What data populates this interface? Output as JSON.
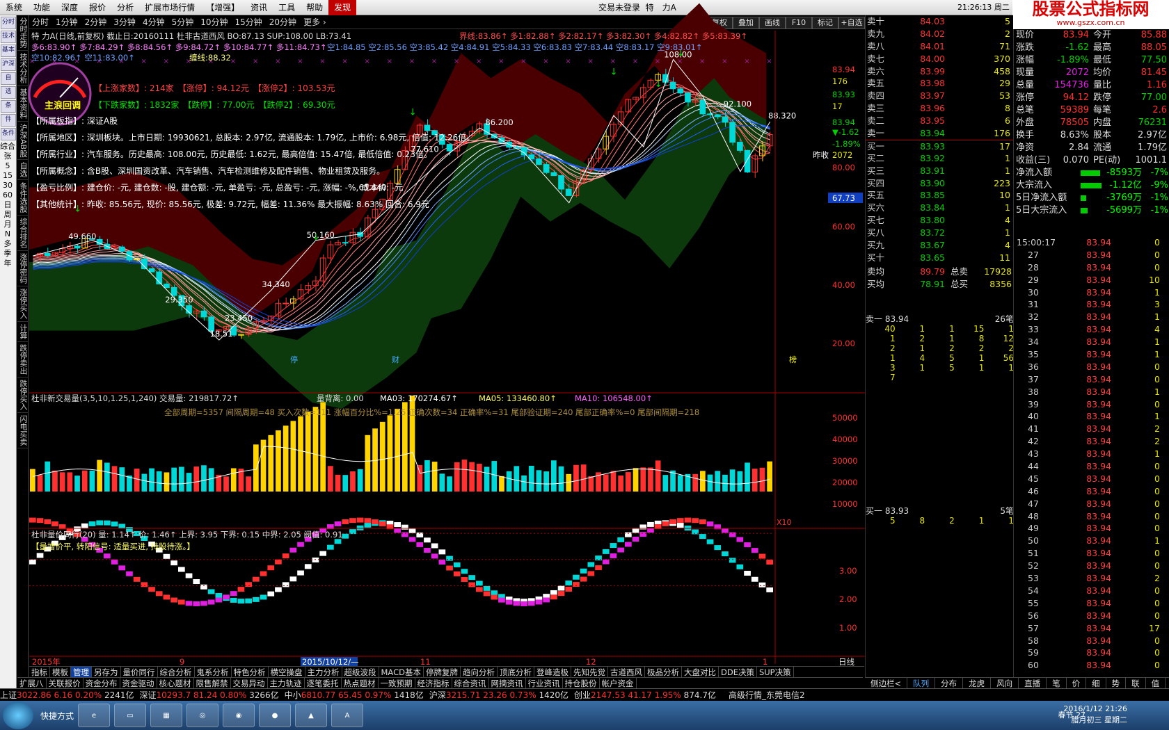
{
  "menu": {
    "items": [
      "系统",
      "功能",
      "深度",
      "报价",
      "分析",
      "扩展市场行情",
      "【增强】",
      "资讯",
      "工具",
      "帮助",
      "发现"
    ],
    "status": "交易未登录",
    "stock": "特　力A",
    "clock": "21:26:13 周二",
    "buttons": [
      "行情",
      "资讯",
      "交易"
    ]
  },
  "logo": {
    "main": "股票公式指标网",
    "sub": "www.gszx.com.cn"
  },
  "left_tools": [
    "分时",
    "技术",
    "基本",
    "沪深",
    "自",
    "选",
    "条",
    "件",
    "条件",
    "综合",
    "张",
    "5",
    "15",
    "30",
    "60",
    "日",
    "周",
    "月",
    "N",
    "多",
    "季",
    "年"
  ],
  "vtabs": [
    "分时走势",
    "技术分析",
    "基本资料",
    "沪深AB股",
    "自选",
    "条件选股",
    "综合排名",
    "涨停密码",
    "涨停买入",
    "计算",
    "跌停卖出",
    "跌停买入",
    "闪电买卖"
  ],
  "period": [
    "分时",
    "1分钟",
    "2分钟",
    "3分钟",
    "4分钟",
    "5分钟",
    "10分钟",
    "15分钟",
    "20分钟",
    "更多 ›"
  ],
  "toolbar_right": [
    "复权",
    "叠加",
    "画线",
    "F10",
    "标记",
    "+自选"
  ],
  "main_chart": {
    "header": "特 力A(日线,前复权) 截止日:20160111  杜非古道西风  BO:87.13  SUP:108.00  LB:73.41",
    "line2_left": "多6:83.90↑ 多7:84.29↑ 多8:84.56↑ 多9:84.72↑ 多10:84.77↑ 多11:84.73↑",
    "line2_right": "空1:84.85 空2:85.56 空3:85.42 空4:84.91 空5:84.33 空6:83.83 空7:83.44 空8:83.17 空9:83.01↑",
    "line1_right": "界线:83.86↑ 多1:82.88↑ 多2:82.17↑ 多3:82.30↑ 多4:82.82↑ 多5:83.39↑",
    "line3": "空10:82.96↑ 空11:83.00↑",
    "line3b": "缠线:88.32",
    "gauge_label": "主浪回调",
    "info": [
      "【上涨家数】: 214家　【涨停】: 94.12元　【涨停2】: 103.53元",
      "【下跌家数】: 1832家　【跌停】: 77.00元　【跌停2】: 69.30元",
      "【所属板指】: 深证A股",
      "【所属地区】: 深圳板块。上市日期: 19930621, 总股本: 2.97亿, 流通股本: 1.79亿, 上市价: 6.98元, 倍值: 12.26倍。",
      "【所属行业】: 汽车服务。历史最高: 108.00元, 历史最低: 1.62元, 最高倍值: 15.47倍, 最低倍值: 0.23倍。",
      "【所属概念】: 含B股、深圳国资改革、汽车销售、汽车检测维修及配件销售、物业租赁及服务。",
      "【盈亏比例】: 建仓价: -元, 建仓数: -股, 建仓额: -元, 单盈亏: -元, 总盈亏: -元, 涨幅: -%, 成本价: -元",
      "【其他统计】: 昨收: 85.56元, 现价: 85.56元, 极差: 9.72元, 幅差: 11.36% 最大振幅: 8.63% 回合: 6.9元"
    ],
    "y_axis": [
      "83.94",
      "176",
      "83.93",
      "17",
      "83.94",
      "▼-1.62",
      "-1.89%",
      "2072",
      "80.00",
      "67.73",
      "60.00",
      "40.00",
      "20.00"
    ],
    "price_labels": [
      "108.00",
      "92.100",
      "88.320",
      "86.200",
      "77.610",
      "65.440",
      "50.160",
      "49.660",
      "34.340",
      "29.350",
      "23.450",
      "18.51"
    ],
    "right_label": "昨收",
    "markers": [
      "停",
      "财",
      "榜"
    ]
  },
  "vol_chart": {
    "header": "杜非新交易量(3,5,10,1.25,1,240) 交易量: 219817.72↑",
    "h2": "量背离: 0.00",
    "ma03": "MA03: 170274.67↑",
    "ma05": "MA05: 133460.80↑",
    "ma10": "MA10: 106548.00↑",
    "stats": "全部周期=5357 间隔周期=48 买入次数=111 涨幅百分比%=1.25 正确次数=34 正确率%=31 尾部验证期=240 尾部正确率%=0 尾部间隔期=218",
    "y_axis": [
      "50000",
      "40000",
      "30000",
      "20000",
      "10000"
    ],
    "x10": "X10"
  },
  "ind_chart": {
    "header": "杜非量价同行(20) 量: 1.14↑ 价: 1.46↑ 上界: 3.95 下界: 0.15 中界: 2.05 阀值: 0.91",
    "signal": "【量增价平, 转阳信号: 适量买进, 持股待涨。】",
    "y_axis": [
      "3.00",
      "2.00",
      "1.00"
    ]
  },
  "x_axis": {
    "labels": [
      "2015年",
      "9",
      "2015/10/12/—",
      "11",
      "12",
      "1"
    ],
    "right": "日线"
  },
  "orderbook": {
    "sells": [
      [
        "卖十",
        "84.03",
        "5"
      ],
      [
        "卖九",
        "84.02",
        "2"
      ],
      [
        "卖八",
        "84.01",
        "71"
      ],
      [
        "卖七",
        "84.00",
        "370"
      ],
      [
        "卖六",
        "83.99",
        "458"
      ],
      [
        "卖五",
        "83.98",
        "29"
      ],
      [
        "卖四",
        "83.97",
        "53"
      ],
      [
        "卖三",
        "83.96",
        "8"
      ],
      [
        "卖二",
        "83.95",
        "6"
      ],
      [
        "卖一",
        "83.94",
        "176"
      ]
    ],
    "buys": [
      [
        "买一",
        "83.93",
        "17"
      ],
      [
        "买二",
        "83.92",
        "1"
      ],
      [
        "买三",
        "83.91",
        "1"
      ],
      [
        "买四",
        "83.90",
        "223"
      ],
      [
        "买五",
        "83.85",
        "10"
      ],
      [
        "买六",
        "83.84",
        "1"
      ],
      [
        "买七",
        "83.80",
        "4"
      ],
      [
        "买八",
        "83.72",
        "1"
      ],
      [
        "买九",
        "83.67",
        "4"
      ],
      [
        "买十",
        "83.65",
        "11"
      ]
    ],
    "avg_sell_label": "卖均",
    "avg_sell": "89.79",
    "total_sell_label": "总卖",
    "total_sell": "17928",
    "avg_buy_label": "买均",
    "avg_buy": "78.91",
    "total_buy_label": "总买",
    "total_buy": "8356",
    "queue1_label": "卖一  83.94",
    "queue1_count": "26笔",
    "queue1": [
      [
        "40",
        "1",
        "1",
        "15",
        "1"
      ],
      [
        "1",
        "2",
        "1",
        "8",
        "12"
      ],
      [
        "2",
        "1",
        "2",
        "2",
        "2"
      ],
      [
        "1",
        "4",
        "5",
        "1",
        "56"
      ],
      [
        "3",
        "1",
        "5",
        "1",
        "1"
      ],
      [
        "7",
        "",
        "",
        "",
        ""
      ]
    ],
    "queue2_label": "买一  83.93",
    "queue2_count": "5笔",
    "queue2": [
      [
        "5",
        "8",
        "2",
        "1",
        "1"
      ]
    ]
  },
  "stats": {
    "rows": [
      [
        "现价",
        "83.94",
        "今开",
        "85.88"
      ],
      [
        "涨跌",
        "-1.62",
        "最高",
        "88.05"
      ],
      [
        "涨幅",
        "-1.89%",
        "最低",
        "77.50"
      ],
      [
        "现量",
        "2072",
        "均价",
        "81.45"
      ],
      [
        "总量",
        "154736",
        "量比",
        "1.16"
      ],
      [
        "涨停",
        "94.12",
        "跌停",
        "77.00"
      ],
      [
        "总笔",
        "59389",
        "每笔",
        "2.6"
      ],
      [
        "外盘",
        "78505",
        "内盘",
        "76231"
      ],
      [
        "换手",
        "8.63%",
        "股本",
        "2.97亿"
      ],
      [
        "净资",
        "2.84",
        "流通",
        "1.79亿"
      ],
      [
        "收益(三)",
        "0.070",
        "PE(动)",
        "1001.1"
      ]
    ],
    "flows": [
      [
        "净流入额",
        "-8593万",
        "-7%"
      ],
      [
        "大宗流入",
        "-1.12亿",
        "-9%"
      ],
      [
        "5日净流入额",
        "-3769万",
        "-1%"
      ],
      [
        "5日大宗流入",
        "-5699万",
        "-1%"
      ]
    ]
  },
  "ticks": {
    "first_time": "15:00:17",
    "rows": [
      [
        "15:00:17",
        "83.94",
        "0"
      ],
      [
        "27",
        "83.94",
        "0"
      ],
      [
        "28",
        "83.94",
        "0"
      ],
      [
        "29",
        "83.94",
        "10"
      ],
      [
        "30",
        "83.94",
        "1"
      ],
      [
        "31",
        "83.94",
        "3"
      ],
      [
        "32",
        "83.94",
        "1"
      ],
      [
        "33",
        "83.94",
        "4"
      ],
      [
        "34",
        "83.94",
        "1"
      ],
      [
        "35",
        "83.94",
        "1"
      ],
      [
        "36",
        "83.94",
        "0"
      ],
      [
        "37",
        "83.94",
        "0"
      ],
      [
        "38",
        "83.94",
        "1"
      ],
      [
        "39",
        "83.94",
        "0"
      ],
      [
        "40",
        "83.94",
        "1"
      ],
      [
        "41",
        "83.94",
        "2"
      ],
      [
        "42",
        "83.94",
        "2"
      ],
      [
        "43",
        "83.94",
        "1"
      ],
      [
        "44",
        "83.94",
        "0"
      ],
      [
        "45",
        "83.94",
        "0"
      ],
      [
        "46",
        "83.94",
        "0"
      ],
      [
        "47",
        "83.94",
        "0"
      ],
      [
        "48",
        "83.94",
        "0"
      ],
      [
        "49",
        "83.94",
        "0"
      ],
      [
        "50",
        "83.94",
        "1"
      ],
      [
        "51",
        "83.94",
        "0"
      ],
      [
        "52",
        "83.94",
        "0"
      ],
      [
        "53",
        "83.94",
        "2"
      ],
      [
        "54",
        "83.94",
        "0"
      ],
      [
        "55",
        "83.94",
        "0"
      ],
      [
        "56",
        "83.94",
        "0"
      ],
      [
        "57",
        "83.94",
        "17"
      ],
      [
        "58",
        "83.94",
        "0"
      ],
      [
        "59",
        "83.94",
        "0"
      ],
      [
        "60",
        "83.94",
        "0"
      ]
    ]
  },
  "bottom_tabs1": [
    "指标",
    "模板",
    "管理",
    "另存为",
    "量价同行",
    "综合分析",
    "鬼系分析",
    "特色分析",
    "横空操盘",
    "主力分析",
    "超级波段",
    "MACD基本",
    "停牌复牌",
    "趋向分析",
    "顶底分析",
    "登峰造极",
    "先知先觉",
    "古道西风",
    "极品分析",
    "大盘对比",
    "DDE决策",
    "SUP决策"
  ],
  "bottom_tabs2": [
    "扩展八",
    "关联报价",
    "资金分布",
    "资金驱动",
    "核心题材",
    "限售解禁",
    "交易异动",
    "主力轨迹",
    "逐笔委托",
    "热点题材",
    "一致预期",
    "经济指标",
    "综合资讯",
    "网摘资讯",
    "行业资讯",
    "持仓股份",
    "帐户资金"
  ],
  "right_tabs": [
    "侧边栏<",
    "队列",
    "分布",
    "龙虎",
    "风向",
    "直播",
    "笔",
    "价",
    "细",
    "势",
    "联",
    "值"
  ],
  "statusbar": [
    {
      "name": "上证",
      "val": "3022.86",
      "chg": "6.16",
      "pct": "0.20%",
      "amt": "2241亿"
    },
    {
      "name": "深证",
      "val": "10293.7",
      "chg": "81.24",
      "pct": "0.80%",
      "amt": "3266亿"
    },
    {
      "name": "中小",
      "val": "6810.77",
      "chg": "65.45",
      "pct": "0.97%",
      "amt": "1418亿"
    },
    {
      "name": "沪深",
      "val": "3215.71",
      "chg": "23.26",
      "pct": "0.73%",
      "amt": "1420亿"
    },
    {
      "name": "创业",
      "val": "2147.53",
      "chg": "41.17",
      "pct": "1.95%",
      "amt": "874.7亿"
    }
  ],
  "status_right": "高级行情_东莞电信2",
  "taskbar": {
    "label": "快捷方式",
    "clock": "2016/1/12 21:26",
    "date": "腊月初三 星期二",
    "ime": "春节 27"
  },
  "colors": {
    "up": "#ff3030",
    "down": "#00d8d8",
    "yellow": "#ffd400",
    "pink": "#ff80c0",
    "magenta": "#e020e0"
  }
}
